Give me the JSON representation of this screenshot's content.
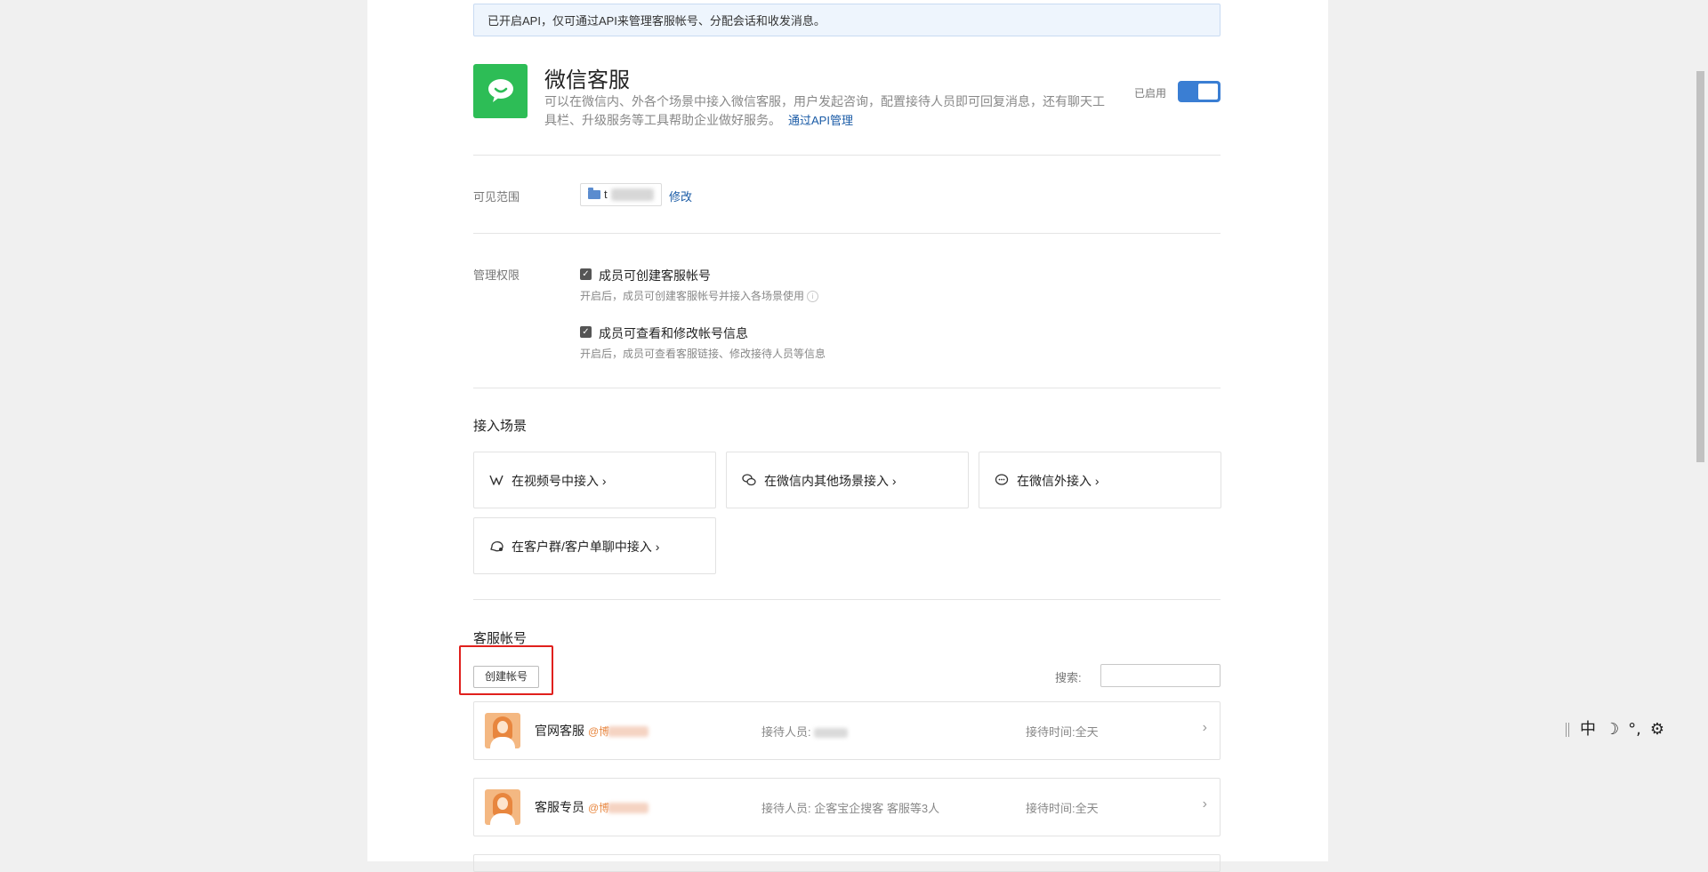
{
  "notice": "已开启API，仅可通过API来管理客服帐号、分配会话和收发消息。",
  "app": {
    "title": "微信客服",
    "description": "可以在微信内、外各个场景中接入微信客服，用户发起咨询，配置接待人员即可回复消息，还有聊天工具栏、升级服务等工具帮助企业做好服务。",
    "api_link": "通过API管理",
    "status_label": "已启用",
    "enabled": true
  },
  "visibility": {
    "label": "可见范围",
    "scope_text": "t",
    "edit_link": "修改"
  },
  "permissions": {
    "label": "管理权限",
    "items": [
      {
        "title": "成员可创建客服帐号",
        "subtitle": "开启后，成员可创建客服帐号并接入各场景使用",
        "checked": true
      },
      {
        "title": "成员可查看和修改帐号信息",
        "subtitle": "开启后，成员可查看客服链接、修改接待人员等信息",
        "checked": true
      }
    ]
  },
  "scenes": {
    "title": "接入场景",
    "items": [
      {
        "label": "在视频号中接入 ›",
        "icon": "channels-icon"
      },
      {
        "label": "在微信内其他场景接入 ›",
        "icon": "wechat-icon"
      },
      {
        "label": "在微信外接入 ›",
        "icon": "chat-bubble-icon"
      },
      {
        "label": "在客户群/客户单聊中接入 ›",
        "icon": "group-chat-icon"
      }
    ]
  },
  "accounts": {
    "title": "客服帐号",
    "create_button": "创建帐号",
    "search_label": "搜索:",
    "search_placeholder": "",
    "list": [
      {
        "name": "官网客服",
        "handle": "@博",
        "reception_label": "接待人员:",
        "reception_value": "",
        "time_label": "接待时间:",
        "time_value": "全天"
      },
      {
        "name": "客服专员",
        "handle": "@博",
        "reception_label": "接待人员:",
        "reception_value": "企客宝企搜客 客服等3人",
        "time_label": "接待时间:",
        "time_value": "全天"
      }
    ]
  },
  "ime": {
    "mode": "中",
    "moon": "☽",
    "punct": "°,",
    "gear": "⚙"
  },
  "colors": {
    "accent": "#3a7ed3",
    "brand_green": "#2dbd56",
    "highlight": "#e0201d",
    "link": "#1a5ba6"
  }
}
